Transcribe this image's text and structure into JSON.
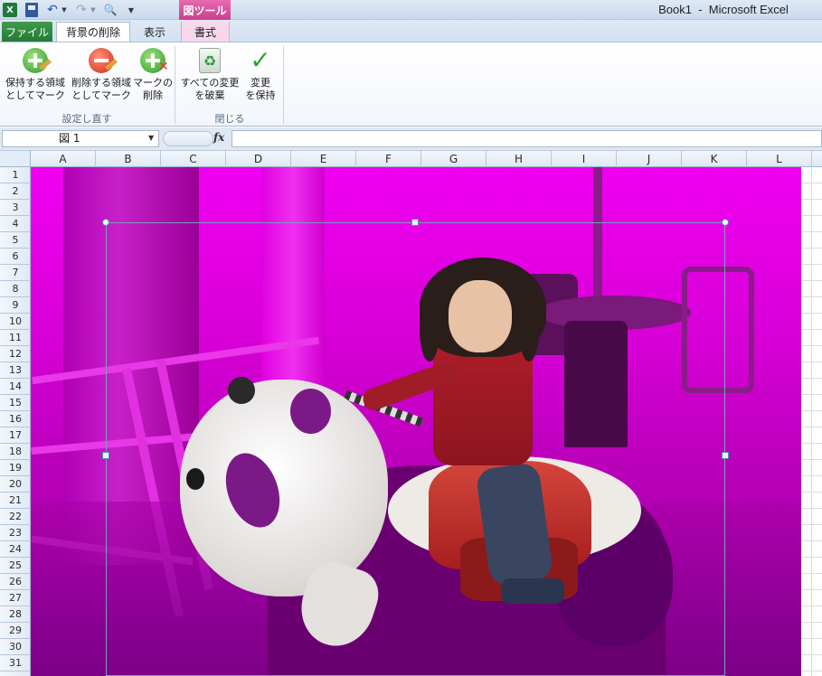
{
  "title_bar": {
    "window_title": "Book1  -  Microsoft Excel",
    "context_tab_header": "図ツール",
    "app_icon_label": "X"
  },
  "quick_access": {
    "icons": [
      "excel-icon",
      "save-icon",
      "undo-icon",
      "redo-icon",
      "print-preview-icon",
      "customize-arrow-icon"
    ]
  },
  "tabs": {
    "file": "ファイル",
    "background_removal": "背景の削除",
    "view": "表示",
    "format": "書式"
  },
  "ribbon": {
    "mark_keep": "保持する領域\nとしてマーク",
    "mark_remove": "削除する領域\nとしてマーク",
    "delete_mark": "マークの\n削除",
    "discard_all": "すべての変更\nを破棄",
    "keep_changes": "変更\nを保持",
    "group_refine": "設定し直す",
    "group_close": "閉じる"
  },
  "formula_bar": {
    "name_box": "図 1",
    "fx_label": "fx",
    "formula": ""
  },
  "grid": {
    "columns": [
      "A",
      "B",
      "C",
      "D",
      "E",
      "F",
      "G",
      "H",
      "I",
      "J",
      "K",
      "L"
    ],
    "rows": [
      "1",
      "2",
      "3",
      "4",
      "5",
      "6",
      "7",
      "8",
      "9",
      "10",
      "11",
      "12",
      "13",
      "14",
      "15",
      "16",
      "17",
      "18",
      "19",
      "20",
      "21",
      "22",
      "23",
      "24",
      "25",
      "26",
      "27",
      "28",
      "29",
      "30",
      "31"
    ]
  },
  "colors": {
    "removal_overlay": "#e000e0",
    "file_tab": "#2f8a3e",
    "context_header": "#d24a9a"
  }
}
